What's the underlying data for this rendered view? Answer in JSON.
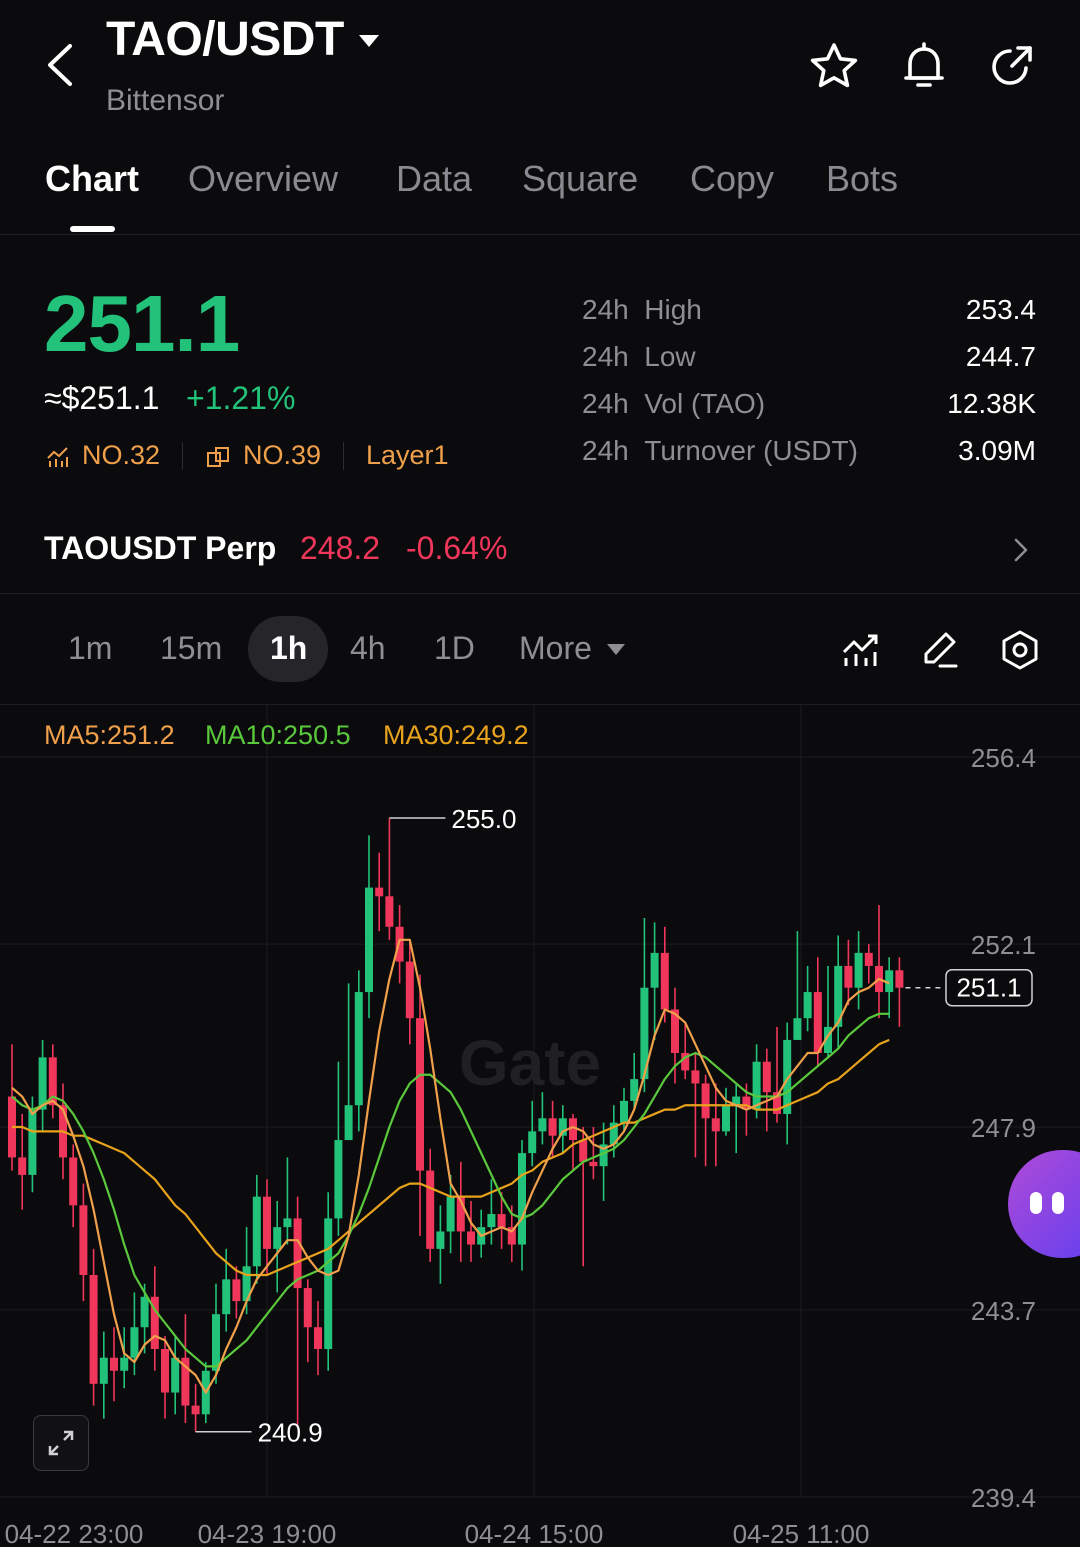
{
  "header": {
    "pair": "TAO/USDT",
    "name": "Bittensor",
    "icons": [
      "back-icon",
      "favorite-star-icon",
      "alert-bell-icon",
      "share-icon"
    ]
  },
  "tabs": [
    {
      "label": "Chart",
      "active": true
    },
    {
      "label": "Overview"
    },
    {
      "label": "Data"
    },
    {
      "label": "Square"
    },
    {
      "label": "Copy"
    },
    {
      "label": "Bots"
    }
  ],
  "ticker": {
    "last_price": "251.1",
    "usd_price": "≈$251.1",
    "change": "+1.21%",
    "rank_mcap": "NO.32",
    "rank_volume": "NO.39",
    "category": "Layer1",
    "stats": [
      {
        "period": "24h",
        "label": "High",
        "value": "253.4"
      },
      {
        "period": "24h",
        "label": "Low",
        "value": "244.7"
      },
      {
        "period": "24h",
        "label": "Vol (TAO)",
        "value": "12.38K"
      },
      {
        "period": "24h",
        "label": "Turnover (USDT)",
        "value": "3.09M"
      }
    ]
  },
  "perp": {
    "name": "TAOUSDT Perp",
    "price": "248.2",
    "change": "-0.64%"
  },
  "intervals": [
    "1m",
    "15m",
    "1h",
    "4h",
    "1D"
  ],
  "active_interval": "1h",
  "more_label": "More",
  "colors": {
    "up": "#22c27a",
    "down": "#f0365a",
    "ma5": "#f0a04a",
    "ma10": "#5ac83c",
    "ma30": "#e8a21c",
    "accent": "#6d3cf0"
  },
  "chart_data": {
    "type": "candlestick",
    "ma_labels": {
      "ma5": "MA5:251.2",
      "ma10": "MA10:250.5",
      "ma30": "MA30:249.2"
    },
    "y_ticks": [
      "256.4",
      "252.1",
      "247.9",
      "243.7",
      "239.4"
    ],
    "x_ticks": [
      "04-22 23:00",
      "04-23 19:00",
      "04-24 15:00",
      "04-25 11:00"
    ],
    "ylim": [
      239.4,
      256.4
    ],
    "high_marker": "255.0",
    "low_marker": "240.9",
    "last_price_label": "251.1",
    "candles": [
      [
        248.6,
        247.2,
        249.8,
        246.9
      ],
      [
        247.2,
        246.8,
        248.2,
        246.0
      ],
      [
        246.8,
        248.3,
        248.6,
        246.4
      ],
      [
        248.3,
        249.5,
        249.9,
        247.8
      ],
      [
        249.5,
        248.4,
        249.8,
        248.1
      ],
      [
        248.4,
        247.2,
        248.9,
        246.7
      ],
      [
        247.2,
        246.1,
        247.5,
        245.6
      ],
      [
        246.1,
        244.5,
        246.6,
        243.9
      ],
      [
        244.5,
        242.0,
        245.1,
        241.5
      ],
      [
        242.0,
        242.6,
        243.2,
        241.2
      ],
      [
        242.6,
        242.3,
        243.3,
        241.6
      ],
      [
        242.3,
        242.6,
        243.3,
        241.9
      ],
      [
        242.6,
        243.3,
        244.1,
        242.2
      ],
      [
        243.3,
        244.0,
        244.3,
        242.7
      ],
      [
        244.0,
        242.8,
        244.7,
        242.3
      ],
      [
        242.8,
        241.8,
        243.1,
        241.2
      ],
      [
        241.8,
        242.6,
        243.1,
        241.3
      ],
      [
        242.6,
        241.5,
        243.6,
        241.1
      ],
      [
        241.5,
        241.3,
        242.0,
        240.9
      ],
      [
        241.3,
        242.3,
        242.5,
        241.1
      ],
      [
        242.3,
        243.6,
        244.3,
        242.0
      ],
      [
        243.6,
        244.4,
        245.1,
        243.2
      ],
      [
        244.4,
        243.9,
        244.7,
        243.5
      ],
      [
        243.9,
        244.7,
        245.6,
        243.6
      ],
      [
        244.7,
        246.3,
        246.8,
        244.3
      ],
      [
        246.3,
        245.1,
        246.7,
        244.5
      ],
      [
        245.1,
        245.6,
        246.2,
        244.1
      ],
      [
        245.6,
        245.8,
        247.2,
        245.2
      ],
      [
        245.8,
        244.2,
        246.3,
        241.0
      ],
      [
        244.2,
        243.3,
        244.4,
        242.5
      ],
      [
        243.3,
        242.8,
        243.9,
        242.2
      ],
      [
        242.8,
        245.8,
        246.4,
        242.3
      ],
      [
        245.8,
        247.6,
        249.4,
        245.4
      ],
      [
        247.6,
        248.4,
        251.2,
        248.1
      ],
      [
        248.4,
        251.0,
        251.5,
        247.8
      ],
      [
        251.0,
        253.4,
        254.6,
        250.4
      ],
      [
        253.4,
        253.2,
        254.2,
        252.4
      ],
      [
        253.2,
        252.5,
        255.0,
        252.2
      ],
      [
        252.5,
        251.7,
        253.0,
        251.2
      ],
      [
        251.7,
        250.4,
        252.2,
        249.8
      ],
      [
        250.4,
        246.9,
        251.4,
        245.4
      ],
      [
        246.9,
        245.1,
        247.4,
        244.8
      ],
      [
        245.1,
        245.5,
        246.1,
        244.3
      ],
      [
        245.5,
        246.3,
        246.8,
        245.0
      ],
      [
        246.3,
        245.5,
        247.1,
        244.8
      ],
      [
        245.5,
        245.2,
        246.2,
        244.8
      ],
      [
        245.2,
        245.6,
        246.0,
        244.9
      ],
      [
        245.6,
        245.9,
        246.7,
        245.2
      ],
      [
        245.9,
        245.6,
        246.4,
        245.1
      ],
      [
        245.6,
        245.2,
        246.1,
        244.8
      ],
      [
        245.2,
        247.3,
        247.6,
        244.6
      ],
      [
        247.3,
        247.8,
        248.5,
        247.0
      ],
      [
        247.8,
        248.1,
        248.7,
        247.5
      ],
      [
        248.1,
        247.7,
        248.5,
        247.2
      ],
      [
        247.7,
        248.1,
        248.4,
        247.3
      ],
      [
        248.1,
        247.6,
        248.2,
        246.9
      ],
      [
        247.6,
        247.1,
        247.9,
        244.7
      ],
      [
        247.1,
        247.0,
        247.9,
        246.7
      ],
      [
        247.0,
        247.5,
        248.0,
        246.2
      ],
      [
        247.5,
        248.0,
        248.4,
        247.2
      ],
      [
        248.0,
        248.5,
        248.8,
        247.8
      ],
      [
        248.5,
        249.0,
        249.6,
        248.3
      ],
      [
        249.0,
        251.1,
        252.7,
        248.7
      ],
      [
        251.1,
        251.9,
        252.6,
        249.9
      ],
      [
        251.9,
        250.6,
        252.5,
        250.3
      ],
      [
        250.6,
        249.6,
        251.1,
        248.9
      ],
      [
        249.6,
        249.2,
        250.3,
        249.0
      ],
      [
        249.2,
        248.9,
        249.6,
        247.2
      ],
      [
        248.9,
        248.1,
        249.1,
        247.0
      ],
      [
        248.1,
        247.8,
        248.9,
        247.0
      ],
      [
        247.8,
        248.4,
        248.8,
        247.7
      ],
      [
        248.4,
        248.6,
        248.9,
        247.3
      ],
      [
        248.6,
        248.3,
        248.9,
        247.7
      ],
      [
        248.3,
        249.4,
        249.8,
        248.1
      ],
      [
        249.4,
        248.7,
        249.7,
        247.8
      ],
      [
        248.7,
        248.2,
        250.2,
        248.0
      ],
      [
        248.2,
        249.9,
        250.3,
        247.5
      ],
      [
        249.9,
        250.4,
        252.4,
        250.0
      ],
      [
        250.4,
        251.0,
        251.6,
        250.1
      ],
      [
        251.0,
        249.6,
        251.8,
        249.3
      ],
      [
        249.6,
        250.2,
        251.6,
        249.5
      ],
      [
        250.2,
        251.6,
        252.3,
        249.7
      ],
      [
        251.6,
        251.1,
        252.2,
        250.7
      ],
      [
        251.1,
        251.9,
        252.4,
        250.6
      ],
      [
        251.9,
        251.6,
        252.1,
        251.2
      ],
      [
        251.6,
        251.0,
        253.0,
        250.4
      ],
      [
        251.0,
        251.5,
        251.8,
        250.4
      ],
      [
        251.5,
        251.1,
        251.8,
        250.2
      ]
    ],
    "ma5": [
      248.8,
      248.6,
      248.2,
      248.4,
      248.5,
      248.3,
      247.7,
      247.0,
      246.0,
      244.8,
      243.6,
      242.7,
      242.5,
      242.9,
      243.1,
      243.0,
      242.6,
      242.4,
      242.2,
      241.8,
      242.2,
      242.8,
      243.3,
      243.9,
      244.4,
      244.7,
      245.0,
      245.3,
      245.3,
      244.9,
      244.6,
      244.5,
      244.6,
      245.4,
      246.8,
      248.5,
      250.1,
      251.3,
      252.2,
      252.2,
      251.1,
      249.7,
      248.1,
      246.6,
      246.2,
      245.7,
      245.4,
      245.5,
      245.6,
      245.5,
      245.8,
      246.4,
      246.9,
      247.4,
      247.8,
      247.9,
      247.8,
      247.5,
      247.4,
      247.5,
      247.8,
      248.3,
      249.1,
      250.0,
      250.6,
      250.5,
      250.3,
      249.8,
      249.3,
      248.8,
      248.5,
      248.4,
      248.3,
      248.4,
      248.5,
      248.6,
      249.0,
      249.3,
      249.6,
      249.6,
      250.0,
      250.3,
      250.8,
      251.0,
      251.1,
      251.3,
      251.2
    ],
    "ma10": [
      248.6,
      248.4,
      248.3,
      248.4,
      248.6,
      248.5,
      248.2,
      247.8,
      247.3,
      246.7,
      246.0,
      245.2,
      244.5,
      244.1,
      243.7,
      243.4,
      243.1,
      242.8,
      242.6,
      242.4,
      242.4,
      242.6,
      242.8,
      243.0,
      243.3,
      243.6,
      243.9,
      244.2,
      244.4,
      244.5,
      244.6,
      244.8,
      245.0,
      245.4,
      245.9,
      246.5,
      247.2,
      247.9,
      248.5,
      248.9,
      249.1,
      249.1,
      248.9,
      248.7,
      248.3,
      247.8,
      247.3,
      246.8,
      246.3,
      245.9,
      245.8,
      245.9,
      246.1,
      246.4,
      246.7,
      246.9,
      247.1,
      247.2,
      247.3,
      247.4,
      247.6,
      247.9,
      248.2,
      248.6,
      249.0,
      249.3,
      249.5,
      249.6,
      249.5,
      249.3,
      249.1,
      248.9,
      248.7,
      248.6,
      248.6,
      248.6,
      248.7,
      248.9,
      249.1,
      249.3,
      249.5,
      249.7,
      250.0,
      250.2,
      250.4,
      250.5,
      250.5
    ],
    "ma30": [
      247.9,
      247.9,
      247.8,
      247.8,
      247.8,
      247.8,
      247.7,
      247.7,
      247.6,
      247.5,
      247.4,
      247.3,
      247.1,
      246.9,
      246.7,
      246.4,
      246.1,
      245.9,
      245.6,
      245.3,
      245.0,
      244.8,
      244.6,
      244.5,
      244.5,
      244.5,
      244.6,
      244.7,
      244.8,
      244.9,
      245.0,
      245.1,
      245.3,
      245.5,
      245.7,
      245.9,
      246.1,
      246.3,
      246.5,
      246.6,
      246.6,
      246.5,
      246.4,
      246.3,
      246.3,
      246.3,
      246.3,
      246.4,
      246.5,
      246.6,
      246.8,
      246.9,
      247.1,
      247.2,
      247.3,
      247.5,
      247.6,
      247.7,
      247.8,
      247.9,
      248.0,
      248.0,
      248.1,
      248.2,
      248.3,
      248.3,
      248.4,
      248.4,
      248.4,
      248.4,
      248.4,
      248.4,
      248.4,
      248.3,
      248.3,
      248.3,
      248.4,
      248.5,
      248.6,
      248.7,
      248.9,
      249.0,
      249.2,
      249.4,
      249.6,
      249.8,
      249.9
    ]
  }
}
